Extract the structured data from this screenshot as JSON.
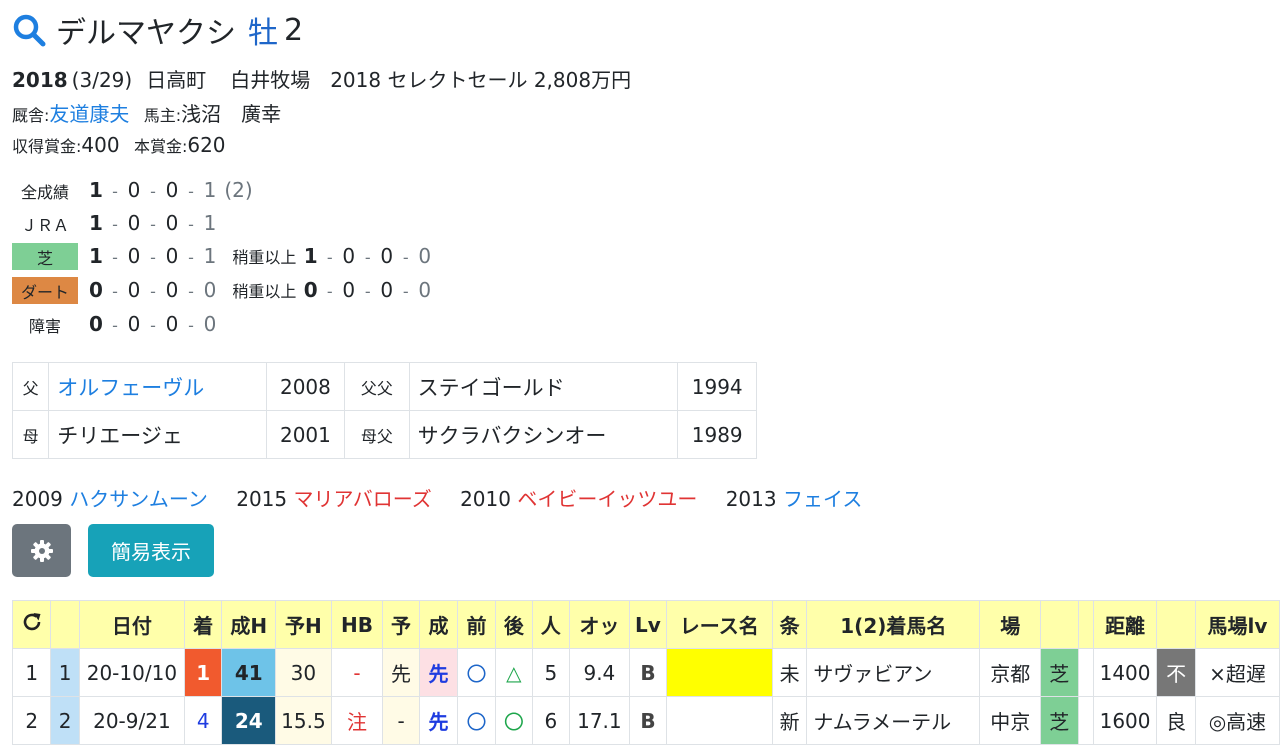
{
  "horse": {
    "name": "デルマヤクシ",
    "sex": "牡",
    "age": "2",
    "birth_year": "2018",
    "birth_date": "(3/29)",
    "town": "日高町",
    "farm": "白井牧場",
    "sale": "2018 セレクトセール 2,808万円",
    "stable_label": "厩舎:",
    "trainer": "友道康夫",
    "owner_label": "馬主:",
    "owner": "浅沼　廣幸",
    "earned_label": "収得賞金:",
    "earned": "400",
    "prize_label": "本賞金:",
    "prize": "620"
  },
  "records": {
    "all": {
      "label": "全成績",
      "w": "1",
      "s": "0",
      "t": "0",
      "o": "1",
      "extra": "(2)"
    },
    "jra": {
      "label": "ＪＲＡ",
      "w": "1",
      "s": "0",
      "t": "0",
      "o": "1"
    },
    "shiba": {
      "label": "芝",
      "w": "1",
      "s": "0",
      "t": "0",
      "o": "1",
      "heavy_label": "稍重以上",
      "hw": "1",
      "hs": "0",
      "ht": "0",
      "ho": "0"
    },
    "dirt": {
      "label": "ダート",
      "w": "0",
      "s": "0",
      "t": "0",
      "o": "0",
      "heavy_label": "稍重以上",
      "hw": "0",
      "hs": "0",
      "ht": "0",
      "ho": "0"
    },
    "jump": {
      "label": "障害",
      "w": "0",
      "s": "0",
      "t": "0",
      "o": "0"
    }
  },
  "pedigree": {
    "sire_label": "父",
    "sire": "オルフェーヴル",
    "sire_year": "2008",
    "sire_sire_label": "父父",
    "sire_sire": "ステイゴールド",
    "sire_sire_year": "1994",
    "dam_label": "母",
    "dam": "チリエージェ",
    "dam_year": "2001",
    "dam_sire_label": "母父",
    "dam_sire": "サクラバクシンオー",
    "dam_sire_year": "1989"
  },
  "siblings": [
    {
      "year": "2009",
      "name": "ハクサンムーン",
      "color": "#1e7fe0"
    },
    {
      "year": "2015",
      "name": "マリアバローズ",
      "color": "#e03434"
    },
    {
      "year": "2010",
      "name": "ベイビーイッツユー",
      "color": "#e03434"
    },
    {
      "year": "2013",
      "name": "フェイス",
      "color": "#1e7fe0"
    }
  ],
  "buttons": {
    "settings_icon": "gear-icon",
    "simple": "簡易表示"
  },
  "table": {
    "refresh_icon": "refresh-icon",
    "headers": [
      "",
      "日付",
      "着",
      "成H",
      "予H",
      "HB",
      "予",
      "成",
      "前",
      "後",
      "人",
      "オッ",
      "Lv",
      "レース名",
      "条",
      "1(2)着馬名",
      "場",
      "",
      "",
      "距離",
      "",
      "馬場lv"
    ],
    "rows": [
      {
        "idx": "1",
        "no": "1",
        "date": "20-10/10",
        "finish": "1",
        "sh": "41",
        "yh": "30",
        "hb": "-",
        "yo": "先",
        "sei": "先",
        "mae": "〇",
        "ato": "△",
        "pop": "5",
        "odds": "9.4",
        "lv": "B",
        "race": "",
        "cond": "未",
        "winner": "サヴァビアン",
        "place": "京都",
        "surface": "芝",
        "dist": "1400",
        "going": "不",
        "track_lv": "×超遅"
      },
      {
        "idx": "2",
        "no": "2",
        "date": "20-9/21",
        "finish": "4",
        "sh": "24",
        "yh": "15.5",
        "hb": "注",
        "yo": "-",
        "sei": "先",
        "mae": "〇",
        "ato": "〇",
        "pop": "6",
        "odds": "17.1",
        "lv": "B",
        "race": "",
        "cond": "新",
        "winner": "ナムラメーテル",
        "place": "中京",
        "surface": "芝",
        "dist": "1600",
        "going": "良",
        "track_lv": "◎高速"
      }
    ]
  }
}
